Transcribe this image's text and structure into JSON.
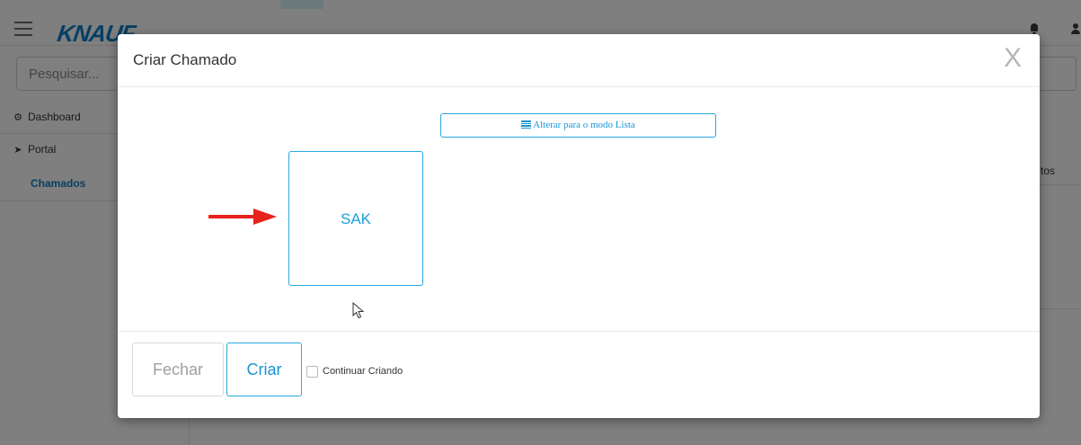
{
  "app": {
    "logo_text": "KNAUF",
    "search_placeholder": "Pesquisar...",
    "sidebar": {
      "items": [
        {
          "label": "Dashboard",
          "icon": "dashboard-icon"
        },
        {
          "label": "Portal",
          "icon": "paper-plane-icon"
        }
      ],
      "active_sub_item": "Chamados"
    },
    "right_tab_partial": "tos"
  },
  "modal": {
    "title": "Criar Chamado",
    "close_label": "X",
    "mode_toggle_label": "Alterar para o modo Lista",
    "cards": [
      {
        "label": "SAK"
      }
    ],
    "footer": {
      "close_button": "Fechar",
      "create_button": "Criar",
      "continue_checkbox_label": "Continuar Criando",
      "continue_checked": false
    }
  },
  "colors": {
    "accent": "#29a8e0",
    "brand": "#0e7fc6",
    "arrow": "#e8221c"
  }
}
